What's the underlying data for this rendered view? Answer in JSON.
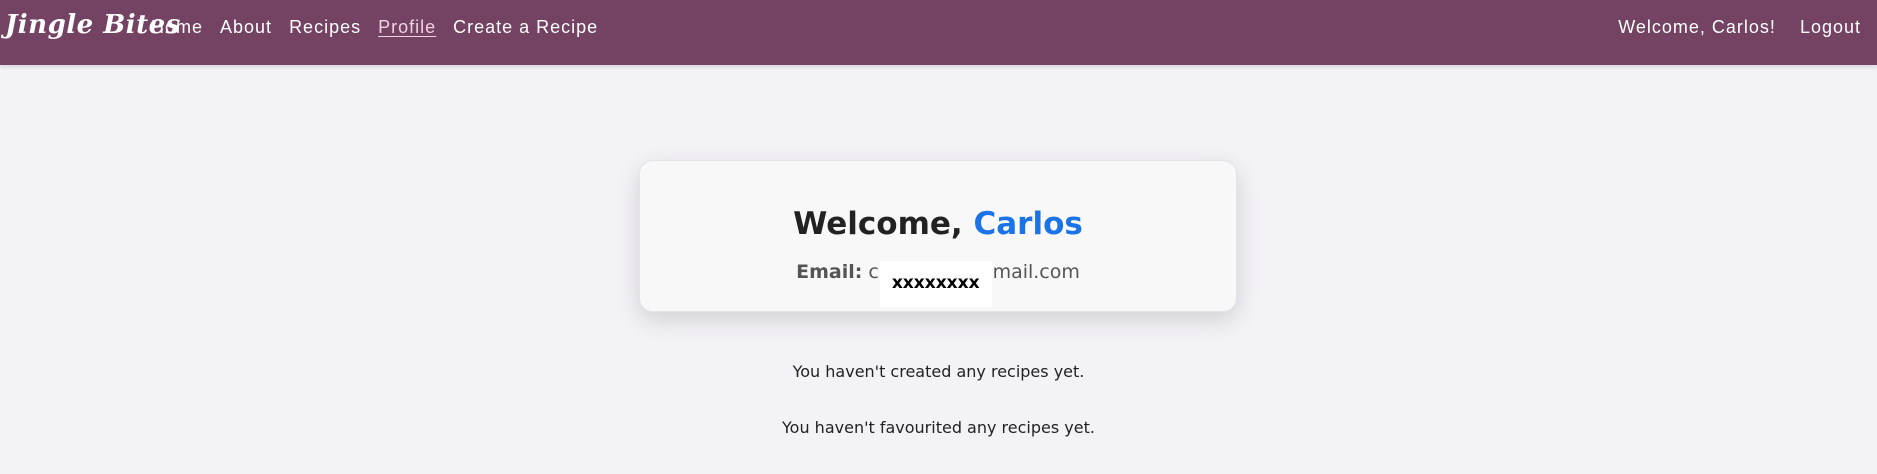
{
  "navbar": {
    "brand": "Jingle Bites",
    "links": [
      {
        "label": "Home"
      },
      {
        "label": "About"
      },
      {
        "label": "Recipes"
      },
      {
        "label": "Profile",
        "active": true
      },
      {
        "label": "Create a Recipe"
      }
    ],
    "welcome": "Welcome, Carlos!",
    "logout": "Logout",
    "background_color": "#744262"
  },
  "profile_card": {
    "welcome_prefix": "Welcome,",
    "user_name": "Carlos",
    "email_label": "Email:",
    "email_start": "c",
    "email_redacted": "xxxxxxxx",
    "email_end": "mail.com",
    "name_color": "#1a73e8"
  },
  "messages": {
    "no_created": "You haven't created any recipes yet.",
    "no_favourited": "You haven't favourited any recipes yet."
  }
}
